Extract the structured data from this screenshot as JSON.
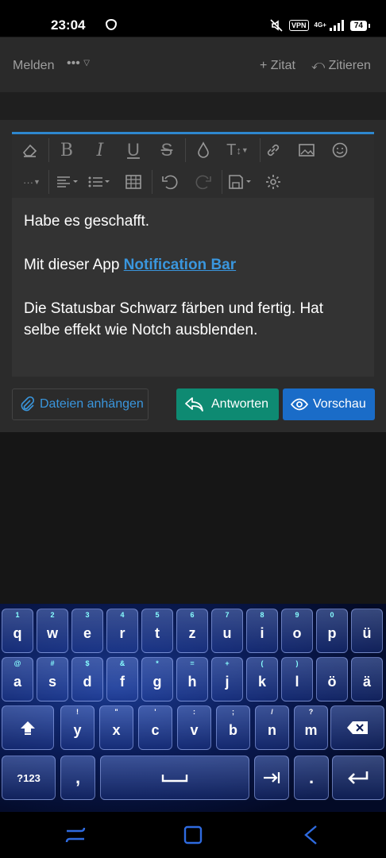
{
  "status_bar": {
    "time": "23:04",
    "vpn": "VPN",
    "network": "4G+",
    "battery": "74"
  },
  "action_bar": {
    "report": "Melden",
    "more": "•••",
    "quote": "+ Zitat",
    "cite": "Zitieren"
  },
  "editor": {
    "accent_color": "#2e87cf",
    "toolbar_icons": [
      "eraser-icon",
      "bold-icon",
      "italic-icon",
      "underline-icon",
      "strikethrough-icon",
      "color-drop-icon",
      "font-size-icon",
      "link-icon",
      "image-icon",
      "smiley-icon",
      "more-dots-icon",
      "align-icon",
      "list-icon",
      "table-icon",
      "undo-icon",
      "redo-icon",
      "save-draft-icon",
      "settings-gear-icon"
    ],
    "line1": "Habe es geschafft.",
    "line2_prefix": "Mit dieser App ",
    "line2_link": "Notification Bar",
    "line3": "Die Statusbar Schwarz färben und fertig. Hat selbe effekt wie Notch ausblenden."
  },
  "buttons": {
    "attach": "Dateien anhängen",
    "reply": "Antworten",
    "preview": "Vorschau"
  },
  "keyboard": {
    "row1": [
      [
        "q",
        "1"
      ],
      [
        "w",
        "2"
      ],
      [
        "e",
        "3"
      ],
      [
        "r",
        "4"
      ],
      [
        "t",
        "5"
      ],
      [
        "z",
        "6"
      ],
      [
        "u",
        "7"
      ],
      [
        "i",
        "8"
      ],
      [
        "o",
        "9"
      ],
      [
        "p",
        "0"
      ],
      [
        "ü",
        ""
      ]
    ],
    "row2": [
      [
        "a",
        "@"
      ],
      [
        "s",
        "#"
      ],
      [
        "d",
        "$"
      ],
      [
        "f",
        "&"
      ],
      [
        "g",
        "*"
      ],
      [
        "h",
        "="
      ],
      [
        "j",
        "+"
      ],
      [
        "k",
        "("
      ],
      [
        "l",
        ")"
      ],
      [
        "ö",
        ""
      ],
      [
        "ä",
        ""
      ]
    ],
    "row3": [
      [
        "y",
        "!"
      ],
      [
        "x",
        "\""
      ],
      [
        "c",
        "'"
      ],
      [
        "v",
        ":"
      ],
      [
        "b",
        ";"
      ],
      [
        "n",
        "/"
      ],
      [
        "m",
        "?"
      ]
    ],
    "symbols_key": "?123",
    "comma_key": ",",
    "period_key": "."
  }
}
